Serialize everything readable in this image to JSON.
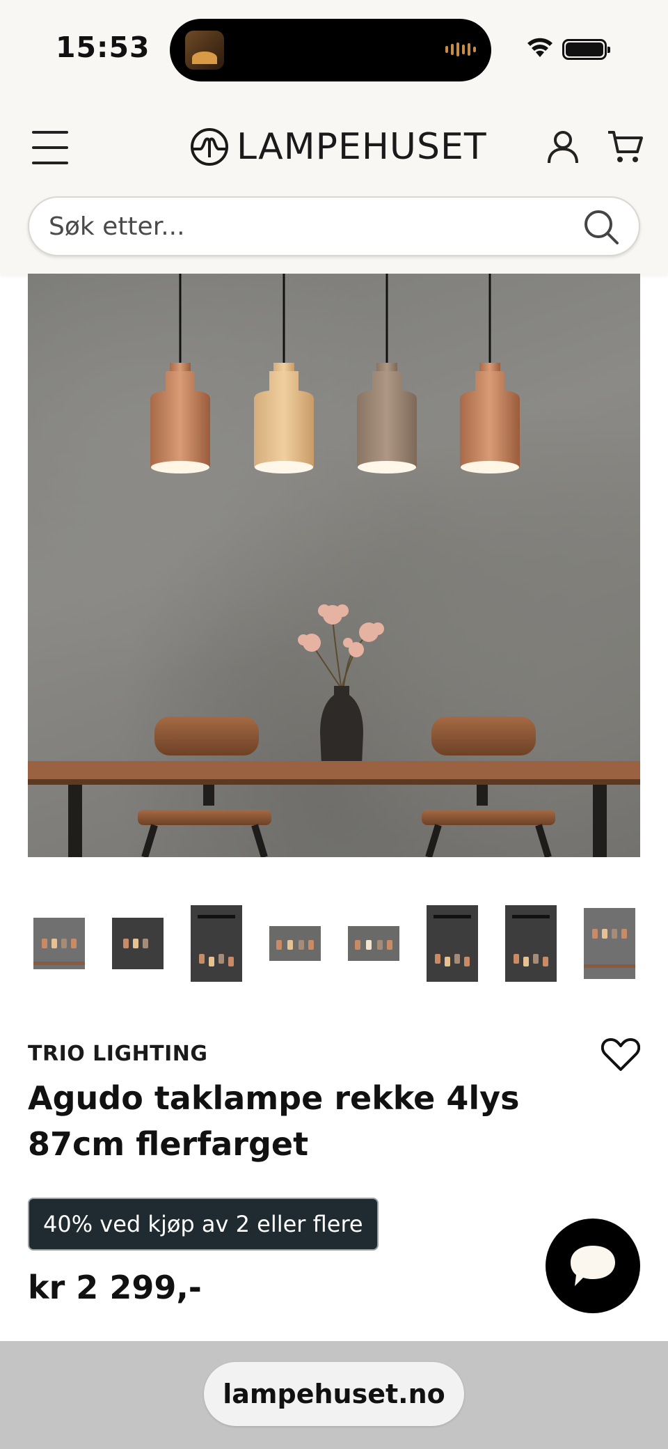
{
  "status_bar": {
    "time": "15:53"
  },
  "header": {
    "logo_text": "LAMPEHUSET",
    "menu_icon": "hamburger-menu-icon",
    "account_icon": "user-icon",
    "cart_icon": "cart-icon"
  },
  "search": {
    "placeholder": "Søk etter...",
    "value": ""
  },
  "product": {
    "brand": "TRIO LIGHTING",
    "title": "Agudo taklampe rekke 4lys 87cm flerfarget",
    "promo": "40% ved kjøp av 2 eller flere",
    "price": "kr 2 299,-"
  },
  "gallery": {
    "thumbnail_count": 8
  },
  "browser": {
    "url": "lampehuset.no"
  },
  "colors": {
    "header_bg": "#f8f7f4",
    "promo_bg": "#1f2b30",
    "chat_bg": "#000000",
    "url_bar_bg": "#c4c4c4"
  }
}
